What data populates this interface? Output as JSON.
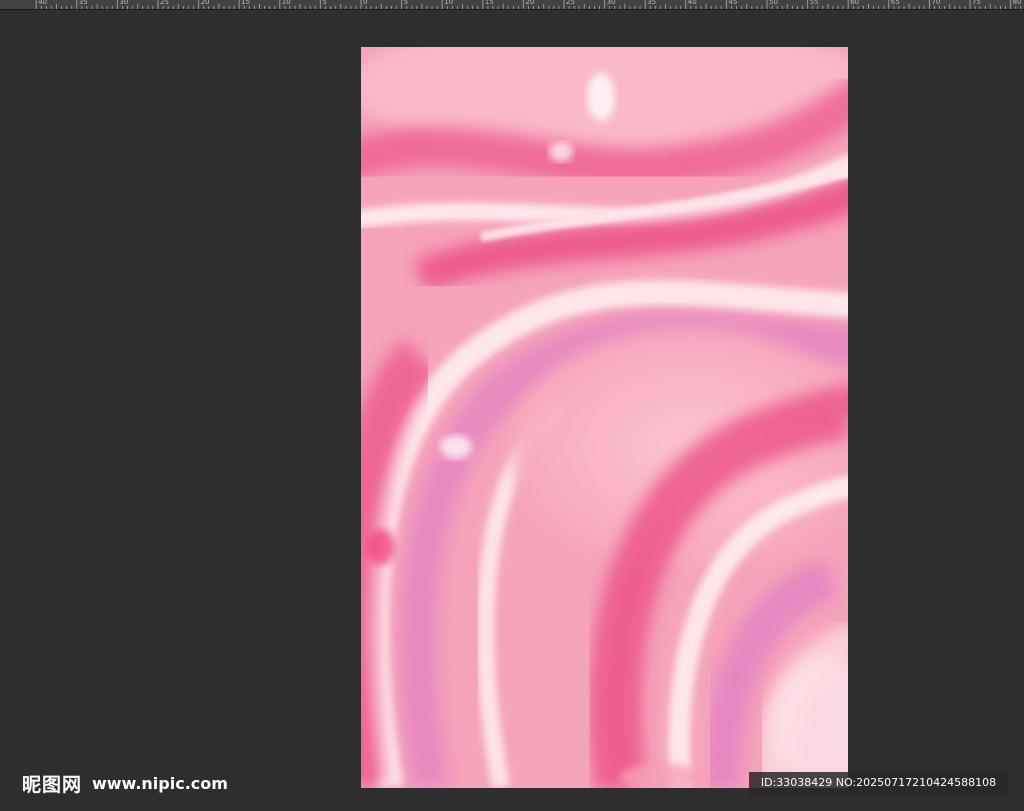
{
  "ruler": {
    "labels": [
      "40",
      "35",
      "30",
      "25",
      "20",
      "15",
      "10",
      "5",
      "0",
      "5",
      "10",
      "15",
      "20",
      "25",
      "30",
      "35",
      "40",
      "45",
      "50",
      "55",
      "60",
      "65",
      "70",
      "75",
      "80"
    ]
  },
  "document": {
    "description_colors": {
      "base": "#f6a6bd",
      "hot_pink": "#ec4f86",
      "light_pink": "#fbd3dd",
      "white_streak": "#fff3f3",
      "magenta": "#e27cc4"
    }
  },
  "watermark": {
    "brand": "昵图网",
    "site": "www.nipic.com",
    "id_text": "ID:33038429 NO:20250717210424588108"
  },
  "colors": {
    "workspace_bg": "#2e2e2e",
    "ruler_bg": "#424242"
  }
}
